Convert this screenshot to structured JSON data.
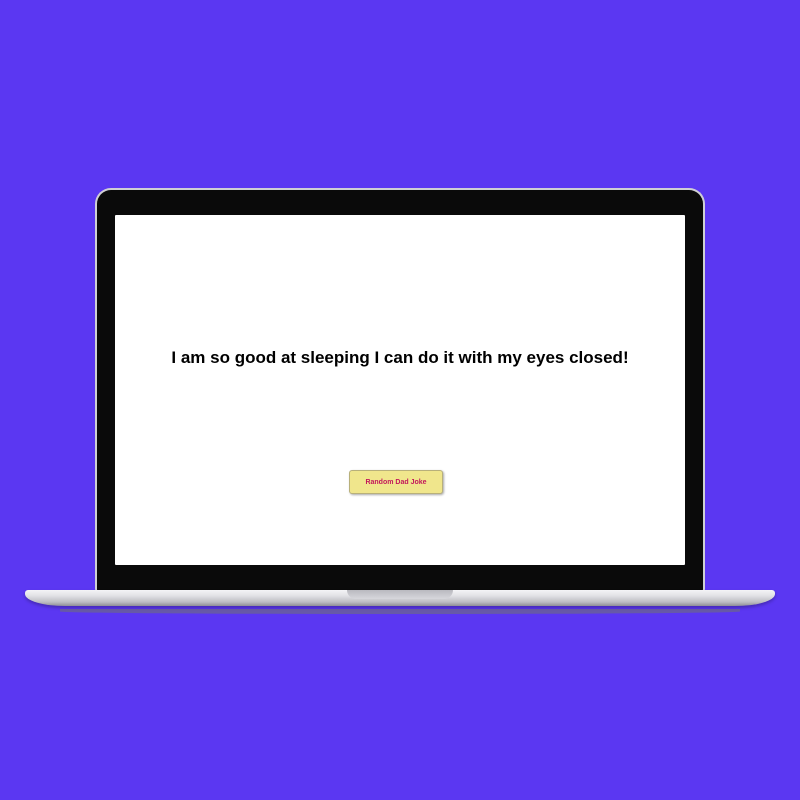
{
  "page": {
    "background_color": "#5b37f2"
  },
  "joke": {
    "text": "I am so good at sleeping I can do it with my eyes closed!"
  },
  "button": {
    "label": "Random Dad Joke",
    "background_color": "#f0e68c",
    "text_color": "#c2185b"
  }
}
